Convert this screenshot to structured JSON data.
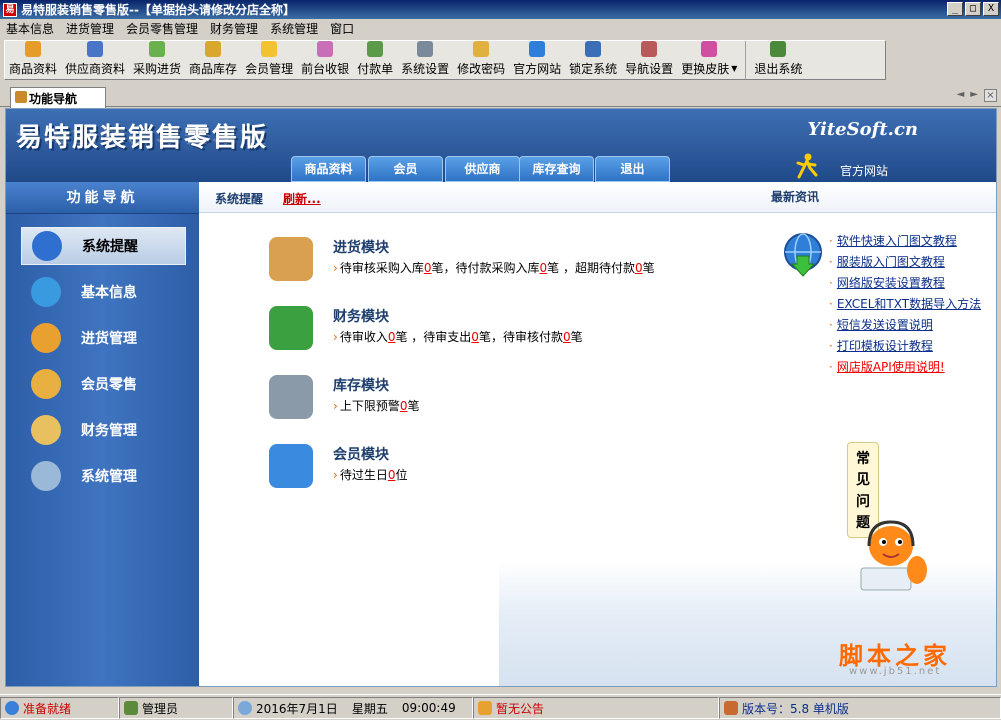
{
  "window": {
    "title": "易特服装销售零售版--【单据抬头请修改分店全称】",
    "app_icon": "易",
    "minimize": "_",
    "maximize": "□",
    "close": "X"
  },
  "menubar": {
    "items": [
      "基本信息",
      "进货管理",
      "会员零售管理",
      "财务管理",
      "系统管理",
      "窗口"
    ]
  },
  "toolbar": {
    "items": [
      {
        "label": "商品资料",
        "icon": "product-icon",
        "color": "#e59c2b"
      },
      {
        "label": "供应商资料",
        "icon": "supplier-icon",
        "color": "#4a74c8"
      },
      {
        "label": "采购进货",
        "icon": "purchase-icon",
        "color": "#6ab04c"
      },
      {
        "label": "商品库存",
        "icon": "inventory-icon",
        "color": "#d9a62e"
      },
      {
        "label": "会员管理",
        "icon": "member-icon",
        "color": "#f2c230"
      },
      {
        "label": "前台收银",
        "icon": "cashier-icon",
        "color": "#c86fb8"
      },
      {
        "label": "付款单",
        "icon": "payment-icon",
        "color": "#5a9a4a"
      },
      {
        "label": "系统设置",
        "icon": "settings-icon",
        "color": "#7a8a9a"
      },
      {
        "label": "修改密码",
        "icon": "key-icon",
        "color": "#e0b040"
      },
      {
        "label": "官方网站",
        "icon": "ie-icon",
        "color": "#2f7fd8"
      },
      {
        "label": "锁定系统",
        "icon": "lock-icon",
        "color": "#3a6fb8"
      },
      {
        "label": "导航设置",
        "icon": "nav-settings-icon",
        "color": "#b85a5a"
      },
      {
        "label": "更换皮肤",
        "icon": "skin-icon",
        "color": "#d04fa0"
      },
      {
        "label": "退出系统",
        "icon": "exit-icon",
        "color": "#4a8a3a"
      }
    ]
  },
  "tabs": {
    "active": "功能导航"
  },
  "banner": {
    "logo": "易特服装销售零售版",
    "brand": "YiteSoft.cn",
    "tabs": [
      "商品资料",
      "会员",
      "供应商",
      "库存查询",
      "退出"
    ],
    "site_link": "官方网站"
  },
  "leftnav": {
    "title": "功能导航",
    "items": [
      {
        "label": "系统提醒",
        "icon": "info-icon",
        "color": "#2f6fd0"
      },
      {
        "label": "基本信息",
        "icon": "cubes-icon",
        "color": "#3a9ae0"
      },
      {
        "label": "进货管理",
        "icon": "box-in-icon",
        "color": "#e8a030"
      },
      {
        "label": "会员零售",
        "icon": "box-out-icon",
        "color": "#e8b040"
      },
      {
        "label": "财务管理",
        "icon": "finance-icon",
        "color": "#e8c060"
      },
      {
        "label": "系统管理",
        "icon": "monitor-icon",
        "color": "#9ab8d8"
      }
    ]
  },
  "content": {
    "bar": {
      "reminder": "系统提醒",
      "refresh": "刷新...",
      "news": "最新资讯"
    },
    "modules": [
      {
        "title": "进货模块",
        "icon": "purchase-box-icon",
        "color": "#d9a050",
        "line": [
          {
            "t": "待审核采购入库"
          },
          {
            "n": "0"
          },
          {
            "t": "笔，待付款采购入库"
          },
          {
            "n": "0"
          },
          {
            "t": "笔 ，超期待付款"
          },
          {
            "n": "0"
          },
          {
            "t": "笔"
          }
        ]
      },
      {
        "title": "财务模块",
        "icon": "dollar-icon",
        "color": "#3aa040",
        "line": [
          {
            "t": "待审收入"
          },
          {
            "n": "0"
          },
          {
            "t": "笔 ，待审支出"
          },
          {
            "n": "0"
          },
          {
            "t": "笔，待审核付款"
          },
          {
            "n": "0"
          },
          {
            "t": "笔"
          }
        ]
      },
      {
        "title": "库存模块",
        "icon": "database-icon",
        "color": "#8a9aa8",
        "line": [
          {
            "t": "上下限预警"
          },
          {
            "n": "0"
          },
          {
            "t": "笔"
          }
        ]
      },
      {
        "title": "会员模块",
        "icon": "member-chat-icon",
        "color": "#3a8ae0",
        "line": [
          {
            "t": "待过生日"
          },
          {
            "n": "0"
          },
          {
            "t": "位"
          }
        ]
      }
    ],
    "news": [
      {
        "label": "软件快速入门图文教程",
        "highlight": false
      },
      {
        "label": "服装版入门图文教程",
        "highlight": false
      },
      {
        "label": "网络版安装设置教程",
        "highlight": false
      },
      {
        "label": "EXCEL和TXT数据导入方法",
        "highlight": false
      },
      {
        "label": "短信发送设置说明",
        "highlight": false
      },
      {
        "label": "打印模板设计教程",
        "highlight": false
      },
      {
        "label": "网店版API使用说明!",
        "highlight": true
      }
    ],
    "faq": [
      "常",
      "见",
      "问",
      "题"
    ],
    "watermark": "脚本之家",
    "watermark_url": "www.jb51.net"
  },
  "statusbar": {
    "ready": "准备就绪",
    "user": "管理员",
    "date": "2016年7月1日",
    "weekday": "星期五",
    "time": "09:00:49",
    "notice": "暂无公告",
    "version": "版本号：5.8 单机版"
  }
}
